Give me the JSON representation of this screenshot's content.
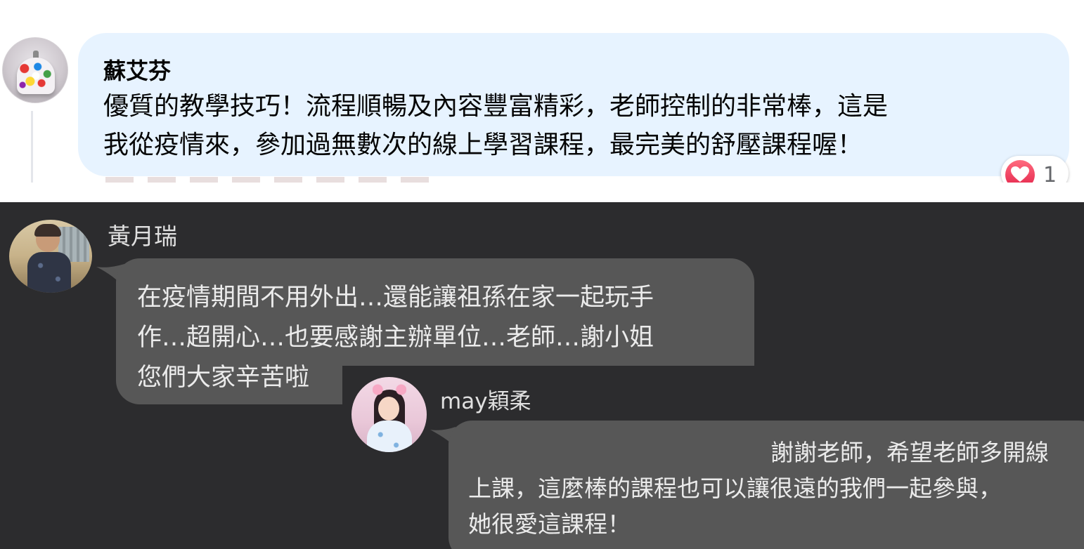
{
  "facebook_comment": {
    "author": "蘇艾芬",
    "text_lines": [
      "優質的教學技巧！流程順暢及內容豐富精彩，老師控制的非常棒，這是",
      "我從疫情來，參加過無數次的線上學習課程，最完美的舒壓課程喔！"
    ],
    "reaction_icon": "heart-reaction-icon",
    "reaction_count": "1",
    "reaction_color": "#e3234a",
    "bubble_color": "#e7f3ff"
  },
  "chat": {
    "background_color": "#2c2c2e",
    "bubble_color": "#575757",
    "messages": [
      {
        "sender": "黃月瑞",
        "lines": [
          "在疫情期間不用外出…還能讓祖孫在家一起玩手",
          "作…超開心…也要感謝主辦單位…老師…謝小姐",
          "您們大家辛苦啦"
        ]
      },
      {
        "sender": "may穎柔",
        "lines": [
          "謝謝老師，希望老師多開線",
          "上課，這麼棒的課程也可以讓很遠的我們一起參與，",
          "她很愛這課程！"
        ]
      }
    ]
  }
}
